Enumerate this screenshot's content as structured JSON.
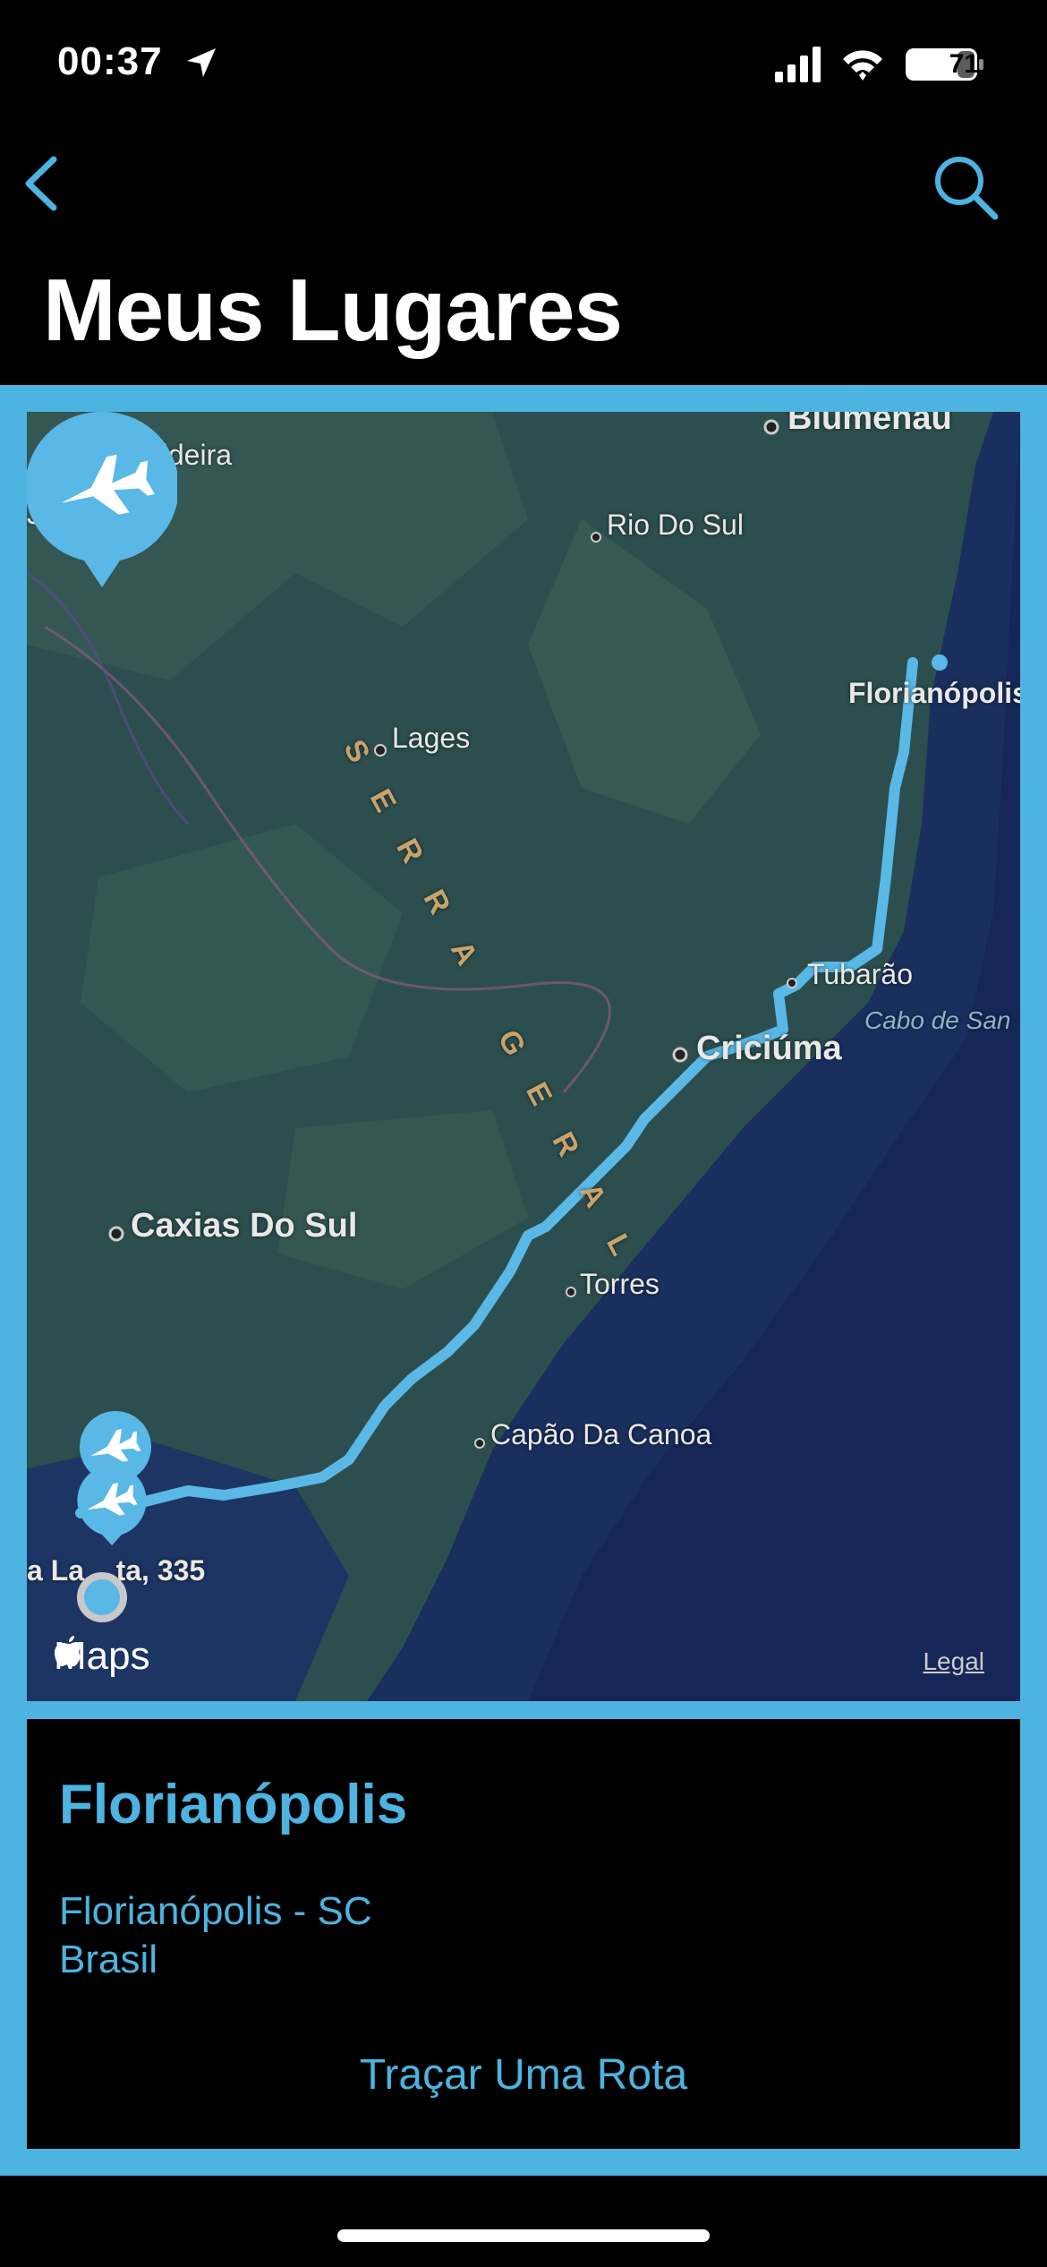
{
  "status": {
    "time": "00:37",
    "battery": "71",
    "icons": [
      "location-arrow-icon",
      "signal-icon",
      "wifi-icon",
      "battery-icon"
    ]
  },
  "nav": {
    "back_icon": "chevron-left-icon",
    "search_icon": "search-icon",
    "title": "Meus Lugares"
  },
  "map": {
    "labels": {
      "blumenau": "Blumenau",
      "videira": "Videira",
      "jo": "Jo",
      "rio_do_sul": "Rio Do Sul",
      "lages": "Lages",
      "serra_geral": "SERRA GERAL",
      "florianopolis": "Florianópolis",
      "tubarao": "Tubarão",
      "cabo": "Cabo de San",
      "criciuma": "Criciúma",
      "caxias": "Caxias Do Sul",
      "torres": "Torres",
      "capao": "Capão Da Canoa",
      "address": "a La    ta, 335"
    },
    "brand": "Maps",
    "legal": "Legal",
    "pins": [
      "airplane-pin-icon",
      "airplane-pin-icon",
      "airplane-pin-icon"
    ],
    "route_color": "#5ab8e6",
    "land_color": "#2c4e4f",
    "sea_color": "#1a2f5e"
  },
  "place": {
    "name": "Florianópolis",
    "line1": "Florianópolis - SC",
    "line2": "Brasil",
    "route_button": "Traçar Uma Rota"
  },
  "colors": {
    "accent": "#4db3e0",
    "background": "#000000"
  }
}
